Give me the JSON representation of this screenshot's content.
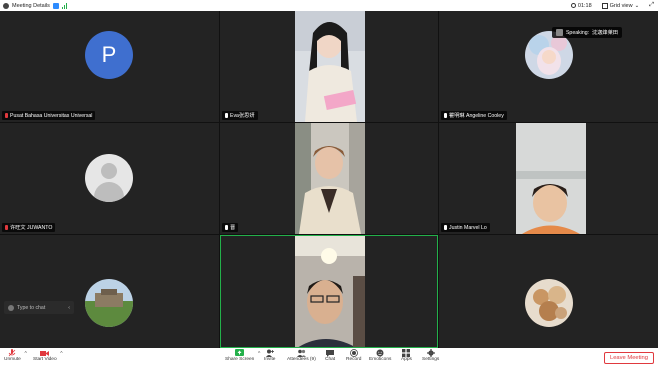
{
  "topbar": {
    "title": "Meeting Details",
    "time": "01:18",
    "view_label": "Grid view"
  },
  "tiles": {
    "t1": {
      "name": "Pusat Bahasa Universitas Universal",
      "avatar_letter": "P"
    },
    "t2": {
      "name": "Eva张思妍"
    },
    "t3": {
      "name": "瞿明琳 Angeline Cooley"
    },
    "t4": {
      "name": "许旺文 JUWANTO"
    },
    "t5": {
      "name": "晋"
    },
    "t6": {
      "name": "Justin Marvel Lo"
    }
  },
  "speaking": {
    "label": "Speaking:",
    "name": "沈迦烽莱田"
  },
  "chat": {
    "placeholder": "Type to chat"
  },
  "toolbar": {
    "unmute": "Unmute",
    "start_video": "Start Video",
    "share_screen": "Share Screen",
    "invite": "Invite",
    "attendees": "Attendees (9)",
    "chat": "Chat",
    "record": "Record",
    "emoticons": "Emoticons",
    "apps": "Apps",
    "settings": "Settings",
    "leave": "Leave Meeting"
  },
  "colors": {
    "accent": "#2d8cff",
    "active_border": "#23b04a",
    "leave_red": "#e0393e",
    "avatar_blue": "#3f6fcf"
  }
}
